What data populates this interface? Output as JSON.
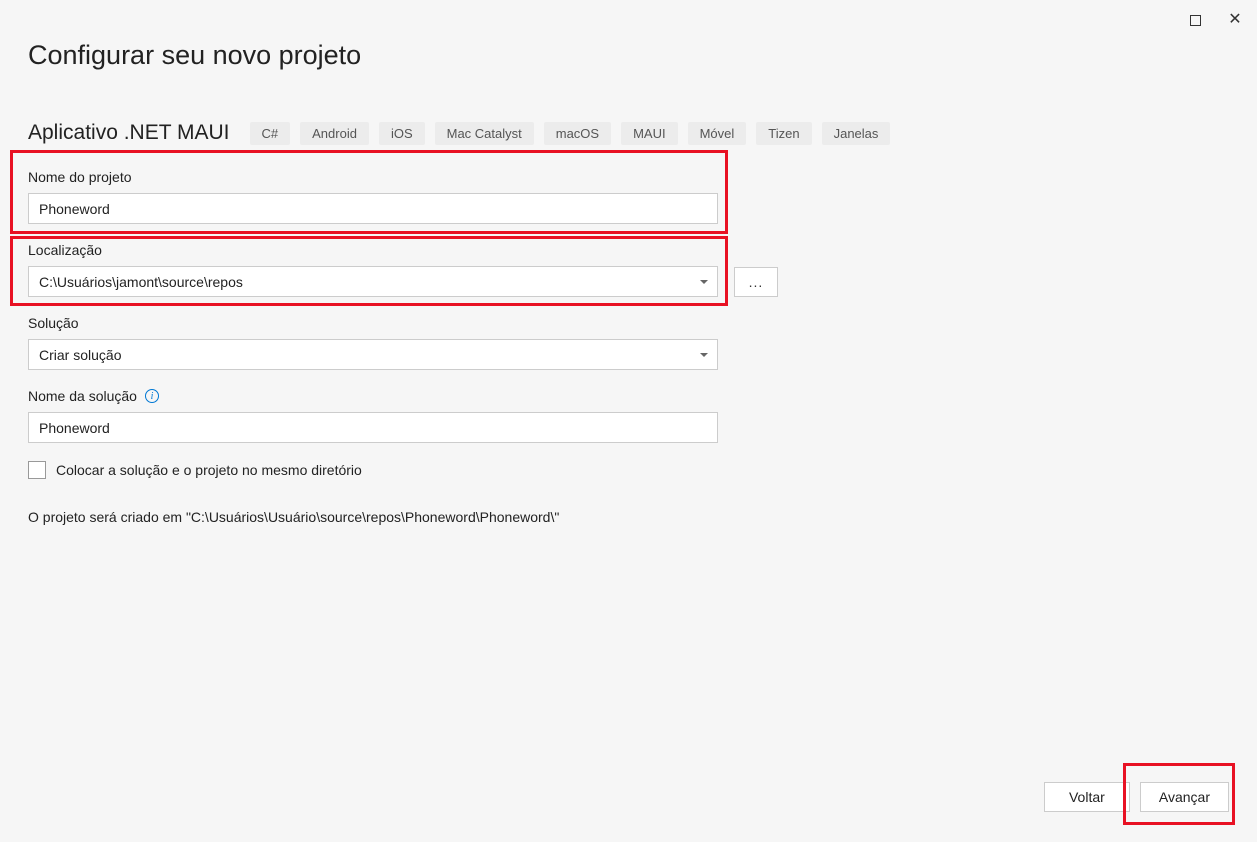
{
  "window": {
    "title": "Configurar seu novo projeto"
  },
  "template": {
    "name": "Aplicativo .NET MAUI",
    "tags": [
      "C#",
      "Android",
      "iOS",
      "Mac Catalyst",
      "macOS",
      "MAUI",
      "Móvel",
      "Tizen",
      "Janelas"
    ]
  },
  "form": {
    "project_name_label": "Nome do projeto",
    "project_name_value": "Phoneword",
    "location_label": "Localização",
    "location_value": "C:\\Usuários\\jamont\\source\\repos",
    "browse_label": "...",
    "solution_label": "Solução",
    "solution_value": "Criar solução",
    "solution_name_label": "Nome da solução",
    "solution_name_value": "Phoneword",
    "same_dir_label": "Colocar a solução e o projeto no mesmo diretório",
    "same_dir_checked": false
  },
  "description": "O projeto será criado em \"C:\\Usuários\\Usuário\\source\\repos\\Phoneword\\Phoneword\\\"",
  "footer": {
    "back_label": "Voltar",
    "next_label": "Avançar"
  }
}
